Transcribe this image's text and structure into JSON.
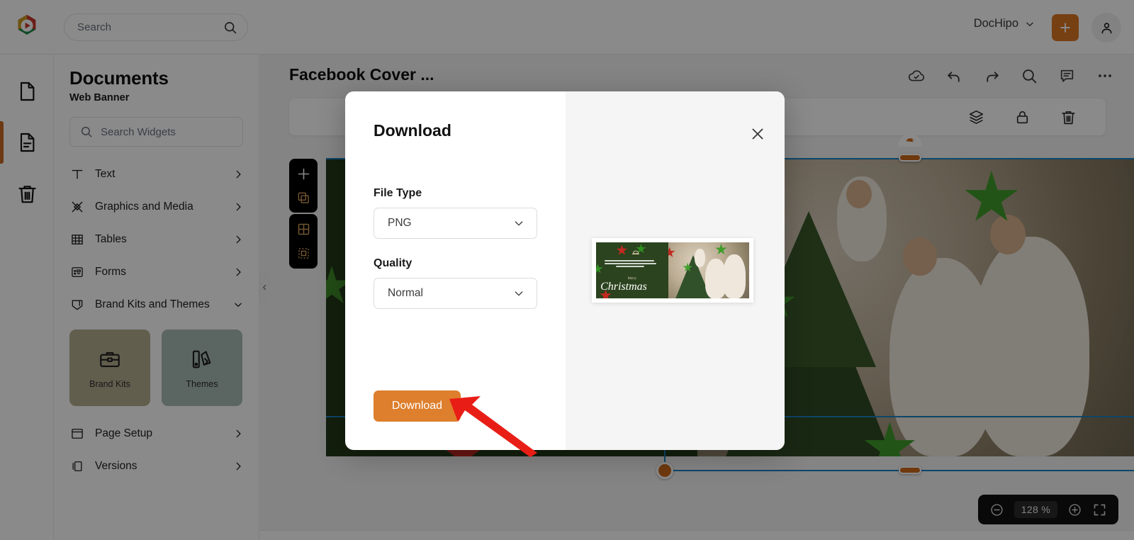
{
  "app": {
    "brand_name": "DocHipo",
    "accent_orange": "#dd7722",
    "accent_blue": "#1a80c4",
    "handle_orange": "#cd6a1b"
  },
  "topbar": {
    "search_placeholder": "Search",
    "search_value": "",
    "brand_menu_label": "DocHipo",
    "add_button_label": "+",
    "icons": {
      "logo": "dochipo-logo-icon",
      "search": "search-icon",
      "chevron": "chevron-down-icon",
      "plus": "plus-icon",
      "account": "account-avatar-icon"
    }
  },
  "rail": {
    "items": [
      {
        "name": "pages",
        "icon": "page-icon",
        "active": false
      },
      {
        "name": "document",
        "icon": "document-text-icon",
        "active": true
      },
      {
        "name": "trash",
        "icon": "trash-icon",
        "active": false
      }
    ]
  },
  "panel": {
    "title": "Documents",
    "subtitle": "Web Banner",
    "widget_search_placeholder": "Search Widgets",
    "widget_search_value": "",
    "menu": [
      {
        "label": "Text",
        "icon": "text-icon",
        "chevron": "chevron-right-icon"
      },
      {
        "label": "Graphics and Media",
        "icon": "graphics-media-icon",
        "chevron": "chevron-right-icon"
      },
      {
        "label": "Tables",
        "icon": "table-icon",
        "chevron": "chevron-right-icon"
      },
      {
        "label": "Forms",
        "icon": "form-icon",
        "chevron": "chevron-right-icon"
      },
      {
        "label": "Brand Kits and Themes",
        "icon": "brand-kit-icon",
        "chevron": "chevron-down-icon"
      }
    ],
    "cards": [
      {
        "label": "Brand Kits",
        "icon": "briefcase-icon",
        "color": "#b5ae90"
      },
      {
        "label": "Themes",
        "icon": "themes-icon",
        "color": "#a8bbb5"
      }
    ],
    "menu_bottom": [
      {
        "label": "Page Setup",
        "icon": "page-setup-icon",
        "chevron": "chevron-right-icon"
      },
      {
        "label": "Versions",
        "icon": "versions-icon",
        "chevron": "chevron-right-icon"
      }
    ],
    "collapse_icon": "chevron-left-icon"
  },
  "canvas": {
    "document_title": "Facebook Cover ...",
    "top_actions": [
      {
        "name": "cloud-saved-icon"
      },
      {
        "name": "undo-icon"
      },
      {
        "name": "redo-icon"
      },
      {
        "name": "zoom-search-icon"
      },
      {
        "name": "comments-icon"
      },
      {
        "name": "more-options-icon"
      }
    ],
    "element_toolbar": [
      {
        "name": "layers-icon"
      },
      {
        "name": "lock-icon"
      },
      {
        "name": "delete-icon"
      }
    ],
    "mini_toolbar_one": [
      {
        "name": "add-element-icon"
      },
      {
        "name": "duplicate-icon"
      }
    ],
    "mini_toolbar_two": [
      {
        "name": "grid-icon"
      },
      {
        "name": "select-area-icon"
      }
    ],
    "banner": {
      "greeting_lines": [
        "Wishing you peace, love, and joy this",
        "Christmas season. May your heart be filled",
        "with happiness."
      ],
      "merry": "Merry",
      "christmas": "Christmas"
    },
    "zoom": {
      "minus_icon": "zoom-out-icon",
      "value": "128 %",
      "plus_icon": "zoom-in-icon",
      "fullscreen_icon": "fullscreen-icon"
    }
  },
  "modal": {
    "title": "Download",
    "close_icon": "close-icon",
    "file_type": {
      "label": "File Type",
      "value": "PNG",
      "chevron": "chevron-down-icon",
      "options": [
        "PNG"
      ]
    },
    "quality": {
      "label": "Quality",
      "value": "Normal",
      "chevron": "chevron-down-icon",
      "options": [
        "Normal"
      ]
    },
    "download_button": "Download",
    "preview": {
      "merry": "Merry",
      "christmas": "Christmas"
    }
  },
  "annotation": {
    "arrow": "red-pointer-arrow",
    "color": "#e81e16"
  }
}
